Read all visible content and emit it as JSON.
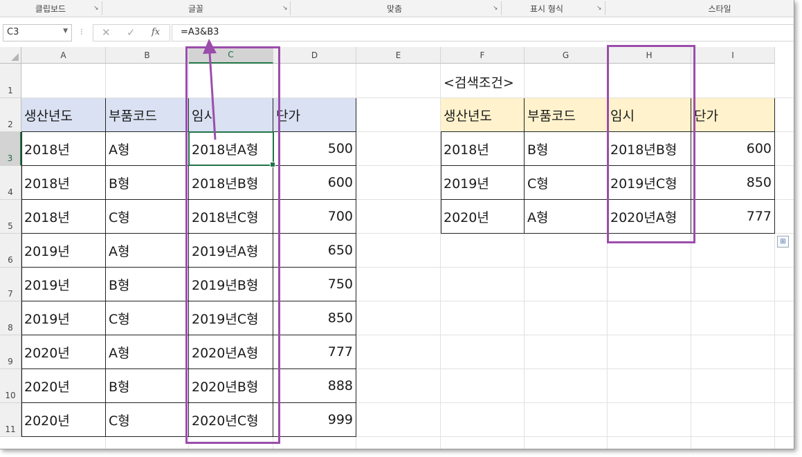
{
  "ribbon": {
    "groups": [
      "클립보드",
      "글꼴",
      "맞춤",
      "표시 형식",
      "스타일"
    ]
  },
  "formula_bar": {
    "name_box": "C3",
    "cancel_icon": "✕",
    "enter_icon": "✓",
    "fx_label": "fx",
    "formula": "=A3&B3"
  },
  "columns": [
    "A",
    "B",
    "C",
    "D",
    "E",
    "F",
    "G",
    "H",
    "I"
  ],
  "rows": [
    "1",
    "2",
    "3",
    "4",
    "5",
    "6",
    "7",
    "8",
    "9",
    "10",
    "11"
  ],
  "main_table": {
    "headers": [
      "생산년도",
      "부품코드",
      "임시",
      "단가"
    ],
    "rows": [
      [
        "2018년",
        "A형",
        "2018년A형",
        "500"
      ],
      [
        "2018년",
        "B형",
        "2018년B형",
        "600"
      ],
      [
        "2018년",
        "C형",
        "2018년C형",
        "700"
      ],
      [
        "2019년",
        "A형",
        "2019년A형",
        "650"
      ],
      [
        "2019년",
        "B형",
        "2019년B형",
        "750"
      ],
      [
        "2019년",
        "C형",
        "2019년C형",
        "850"
      ],
      [
        "2020년",
        "A형",
        "2020년A형",
        "777"
      ],
      [
        "2020년",
        "B형",
        "2020년B형",
        "888"
      ],
      [
        "2020년",
        "C형",
        "2020년C형",
        "999"
      ]
    ]
  },
  "criteria_table": {
    "title": "<검색조건>",
    "headers": [
      "생산년도",
      "부품코드",
      "임시",
      "단가"
    ],
    "rows": [
      [
        "2018년",
        "B형",
        "2018년B형",
        "600"
      ],
      [
        "2019년",
        "C형",
        "2019년C형",
        "850"
      ],
      [
        "2020년",
        "A형",
        "2020년A형",
        "777"
      ]
    ]
  },
  "colors": {
    "main_header_fill": "#d9e1f2",
    "criteria_header_fill": "#fff2cc",
    "highlight": "#9b4dab",
    "selection": "#217346"
  }
}
